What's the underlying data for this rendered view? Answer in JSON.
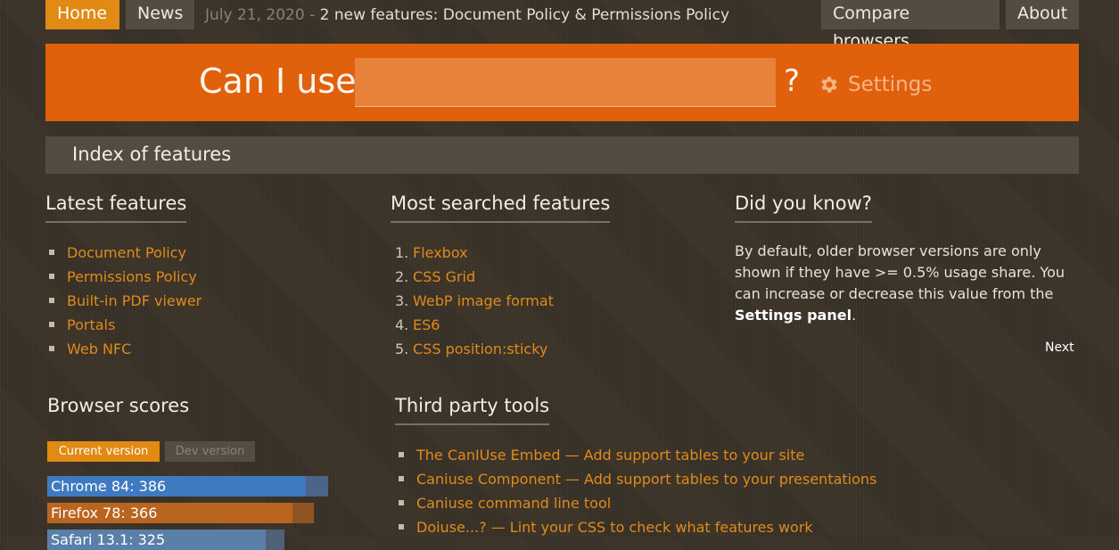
{
  "nav": {
    "home": "Home",
    "news": "News",
    "news_date": "July 21, 2020 - ",
    "news_headline": "2 new features: Document Policy & Permissions Policy",
    "compare": "Compare browsers",
    "about": "About"
  },
  "search": {
    "label": "Can I use",
    "value": "",
    "qmark": "?",
    "settings_icon": "gear-icon",
    "settings_label": "Settings"
  },
  "index_title": "Index of features",
  "latest": {
    "title": "Latest features",
    "items": [
      "Document Policy",
      "Permissions Policy",
      "Built-in PDF viewer",
      "Portals",
      "Web NFC"
    ]
  },
  "most_searched": {
    "title": "Most searched features",
    "items": [
      {
        "n": "1.",
        "label": "Flexbox"
      },
      {
        "n": "2.",
        "label": "CSS Grid"
      },
      {
        "n": "3.",
        "label": "WebP image format"
      },
      {
        "n": "4.",
        "label": "ES6"
      },
      {
        "n": "5.",
        "label": "CSS position:sticky"
      }
    ]
  },
  "did_you_know": {
    "title": "Did you know?",
    "text_before": "By default, older browser versions are only shown if they have >= 0.5% usage share. You can increase or decrease this value from the ",
    "text_bold": "Settings panel",
    "text_after": ".",
    "next": "Next"
  },
  "scores": {
    "title": "Browser scores",
    "tab_current": "Current version",
    "tab_dev": "Dev version",
    "bars": [
      {
        "label": "Chrome 84: 386",
        "score": 386,
        "color": "#3f7ac0",
        "track": "#4b6487"
      },
      {
        "label": "Firefox 78: 366",
        "score": 366,
        "color": "#b9651f",
        "track": "#8f5421"
      },
      {
        "label": "Safari 13.1: 325",
        "score": 325,
        "color": "#5a7fa8",
        "track": "#4e6177"
      }
    ],
    "max": 405
  },
  "tools": {
    "title": "Third party tools",
    "items": [
      "The CanIUse Embed — Add support tables to your site",
      "Caniuse Component — Add support tables to your presentations",
      "Caniuse command line tool",
      "Doiuse...? — Lint your CSS to check what features work"
    ]
  }
}
